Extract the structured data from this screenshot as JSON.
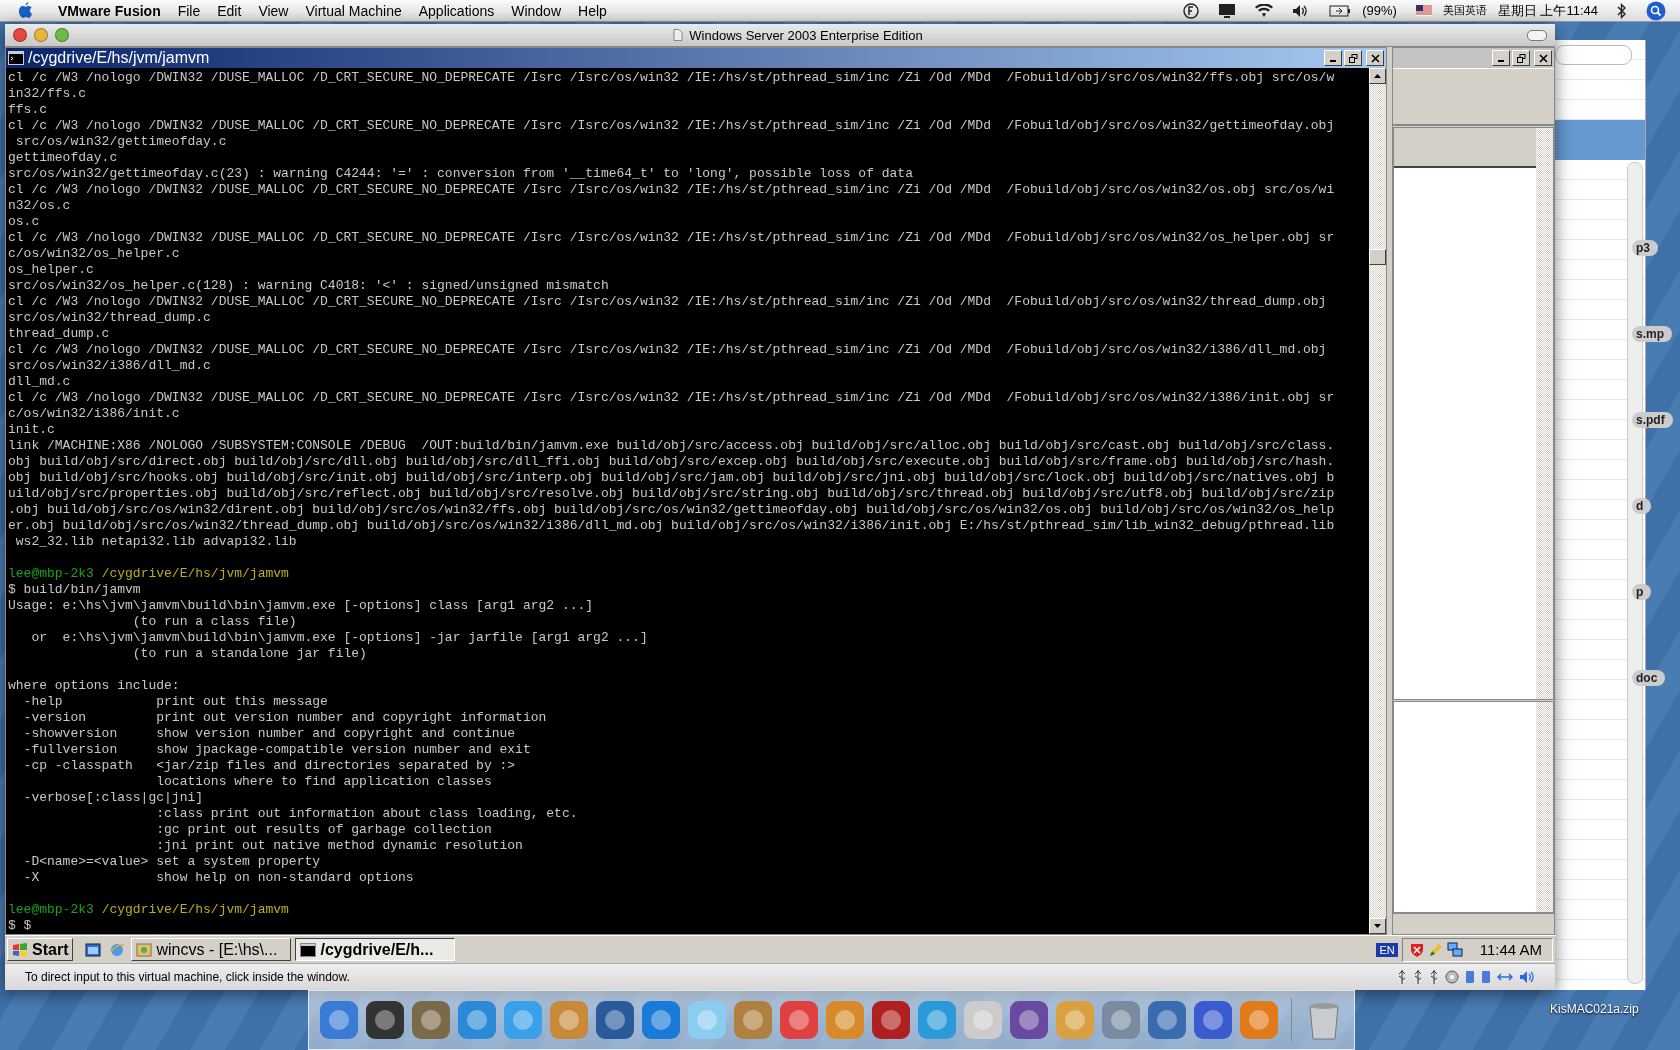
{
  "menu_bar": {
    "app_name": "VMware Fusion",
    "menus": [
      "File",
      "Edit",
      "View",
      "Virtual Machine",
      "Applications",
      "Window",
      "Help"
    ],
    "battery": "(99%)",
    "input_method": "美国英语",
    "clock": "星期日 上午11:44"
  },
  "vm_window": {
    "title": "Windows Server 2003 Enterprise Edition",
    "status_bar": "To direct input to this virtual machine, click inside the window."
  },
  "console": {
    "title": "/cygdrive/E/hs/jvm/jamvm",
    "lines": [
      {
        "kind": "text",
        "text": "cl /c /W3 /nologo /DWIN32 /DUSE_MALLOC /D_CRT_SECURE_NO_DEPRECATE /Isrc /Isrc/os/win32 /IE:/hs/st/pthread_sim/inc /Zi /Od /MDd  /Fobuild/obj/src/os/win32/ffs.obj src/os/w"
      },
      {
        "kind": "text",
        "text": "in32/ffs.c"
      },
      {
        "kind": "text",
        "text": "ffs.c"
      },
      {
        "kind": "text",
        "text": "cl /c /W3 /nologo /DWIN32 /DUSE_MALLOC /D_CRT_SECURE_NO_DEPRECATE /Isrc /Isrc/os/win32 /IE:/hs/st/pthread_sim/inc /Zi /Od /MDd  /Fobuild/obj/src/os/win32/gettimeofday.obj"
      },
      {
        "kind": "text",
        "text": " src/os/win32/gettimeofday.c"
      },
      {
        "kind": "text",
        "text": "gettimeofday.c"
      },
      {
        "kind": "text",
        "text": "src/os/win32/gettimeofday.c(23) : warning C4244: '=' : conversion from '__time64_t' to 'long', possible loss of data"
      },
      {
        "kind": "text",
        "text": "cl /c /W3 /nologo /DWIN32 /DUSE_MALLOC /D_CRT_SECURE_NO_DEPRECATE /Isrc /Isrc/os/win32 /IE:/hs/st/pthread_sim/inc /Zi /Od /MDd  /Fobuild/obj/src/os/win32/os.obj src/os/wi"
      },
      {
        "kind": "text",
        "text": "n32/os.c"
      },
      {
        "kind": "text",
        "text": "os.c"
      },
      {
        "kind": "text",
        "text": "cl /c /W3 /nologo /DWIN32 /DUSE_MALLOC /D_CRT_SECURE_NO_DEPRECATE /Isrc /Isrc/os/win32 /IE:/hs/st/pthread_sim/inc /Zi /Od /MDd  /Fobuild/obj/src/os/win32/os_helper.obj sr"
      },
      {
        "kind": "text",
        "text": "c/os/win32/os_helper.c"
      },
      {
        "kind": "text",
        "text": "os_helper.c"
      },
      {
        "kind": "text",
        "text": "src/os/win32/os_helper.c(128) : warning C4018: '<' : signed/unsigned mismatch"
      },
      {
        "kind": "text",
        "text": "cl /c /W3 /nologo /DWIN32 /DUSE_MALLOC /D_CRT_SECURE_NO_DEPRECATE /Isrc /Isrc/os/win32 /IE:/hs/st/pthread_sim/inc /Zi /Od /MDd  /Fobuild/obj/src/os/win32/thread_dump.obj"
      },
      {
        "kind": "text",
        "text": "src/os/win32/thread_dump.c"
      },
      {
        "kind": "text",
        "text": "thread_dump.c"
      },
      {
        "kind": "text",
        "text": "cl /c /W3 /nologo /DWIN32 /DUSE_MALLOC /D_CRT_SECURE_NO_DEPRECATE /Isrc /Isrc/os/win32 /IE:/hs/st/pthread_sim/inc /Zi /Od /MDd  /Fobuild/obj/src/os/win32/i386/dll_md.obj"
      },
      {
        "kind": "text",
        "text": "src/os/win32/i386/dll_md.c"
      },
      {
        "kind": "text",
        "text": "dll_md.c"
      },
      {
        "kind": "text",
        "text": "cl /c /W3 /nologo /DWIN32 /DUSE_MALLOC /D_CRT_SECURE_NO_DEPRECATE /Isrc /Isrc/os/win32 /IE:/hs/st/pthread_sim/inc /Zi /Od /MDd  /Fobuild/obj/src/os/win32/i386/init.obj sr"
      },
      {
        "kind": "text",
        "text": "c/os/win32/i386/init.c"
      },
      {
        "kind": "text",
        "text": "init.c"
      },
      {
        "kind": "text",
        "text": "link /MACHINE:X86 /NOLOGO /SUBSYSTEM:CONSOLE /DEBUG  /OUT:build/bin/jamvm.exe build/obj/src/access.obj build/obj/src/alloc.obj build/obj/src/cast.obj build/obj/src/class."
      },
      {
        "kind": "text",
        "text": "obj build/obj/src/direct.obj build/obj/src/dll.obj build/obj/src/dll_ffi.obj build/obj/src/excep.obj build/obj/src/execute.obj build/obj/src/frame.obj build/obj/src/hash."
      },
      {
        "kind": "text",
        "text": "obj build/obj/src/hooks.obj build/obj/src/init.obj build/obj/src/interp.obj build/obj/src/jam.obj build/obj/src/jni.obj build/obj/src/lock.obj build/obj/src/natives.obj b"
      },
      {
        "kind": "text",
        "text": "uild/obj/src/properties.obj build/obj/src/reflect.obj build/obj/src/resolve.obj build/obj/src/string.obj build/obj/src/thread.obj build/obj/src/utf8.obj build/obj/src/zip"
      },
      {
        "kind": "text",
        "text": ".obj build/obj/src/os/win32/dirent.obj build/obj/src/os/win32/ffs.obj build/obj/src/os/win32/gettimeofday.obj build/obj/src/os/win32/os.obj build/obj/src/os/win32/os_help"
      },
      {
        "kind": "text",
        "text": "er.obj build/obj/src/os/win32/thread_dump.obj build/obj/src/os/win32/i386/dll_md.obj build/obj/src/os/win32/i386/init.obj E:/hs/st/pthread_sim/lib_win32_debug/pthread.lib"
      },
      {
        "kind": "text",
        "text": " ws2_32.lib netapi32.lib advapi32.lib"
      },
      {
        "kind": "blank"
      },
      {
        "kind": "prompt",
        "user": "lee@mbp-2k3",
        "path": "/cygdrive/E/hs/jvm/jamvm"
      },
      {
        "kind": "text",
        "text": "$ build/bin/jamvm"
      },
      {
        "kind": "text",
        "text": "Usage: e:\\hs\\jvm\\jamvm\\build\\bin\\jamvm.exe [-options] class [arg1 arg2 ...]"
      },
      {
        "kind": "text",
        "text": "                (to run a class file)"
      },
      {
        "kind": "text",
        "text": "   or  e:\\hs\\jvm\\jamvm\\build\\bin\\jamvm.exe [-options] -jar jarfile [arg1 arg2 ...]"
      },
      {
        "kind": "text",
        "text": "                (to run a standalone jar file)"
      },
      {
        "kind": "blank"
      },
      {
        "kind": "text",
        "text": "where options include:"
      },
      {
        "kind": "text",
        "text": "  -help            print out this message"
      },
      {
        "kind": "text",
        "text": "  -version         print out version number and copyright information"
      },
      {
        "kind": "text",
        "text": "  -showversion     show version number and copyright and continue"
      },
      {
        "kind": "text",
        "text": "  -fullversion     show jpackage-compatible version number and exit"
      },
      {
        "kind": "text",
        "text": "  -cp -classpath   <jar/zip files and directories separated by :>"
      },
      {
        "kind": "text",
        "text": "                   locations where to find application classes"
      },
      {
        "kind": "text",
        "text": "  -verbose[:class|gc|jni]"
      },
      {
        "kind": "text",
        "text": "                   :class print out information about class loading, etc."
      },
      {
        "kind": "text",
        "text": "                   :gc print out results of garbage collection"
      },
      {
        "kind": "text",
        "text": "                   :jni print out native method dynamic resolution"
      },
      {
        "kind": "text",
        "text": "  -D<name>=<value> set a system property"
      },
      {
        "kind": "text",
        "text": "  -X               show help on non-standard options"
      },
      {
        "kind": "blank"
      },
      {
        "kind": "prompt",
        "user": "lee@mbp-2k3",
        "path": "/cygdrive/E/hs/jvm/jamvm"
      },
      {
        "kind": "text",
        "text": "$ $"
      }
    ]
  },
  "taskbar": {
    "start": "Start",
    "tasks": [
      {
        "label": "wincvs - [E:\\hs\\...",
        "selected": false
      },
      {
        "label": "/cygdrive/E/h...",
        "selected": true
      }
    ],
    "language": "EN",
    "clock": "11:44 AM"
  },
  "desktop": {
    "labels": [
      "p3",
      "s.mp",
      "s.pdf",
      "d",
      "p",
      "doc"
    ],
    "file_label": "KisMAC021a.zip"
  }
}
